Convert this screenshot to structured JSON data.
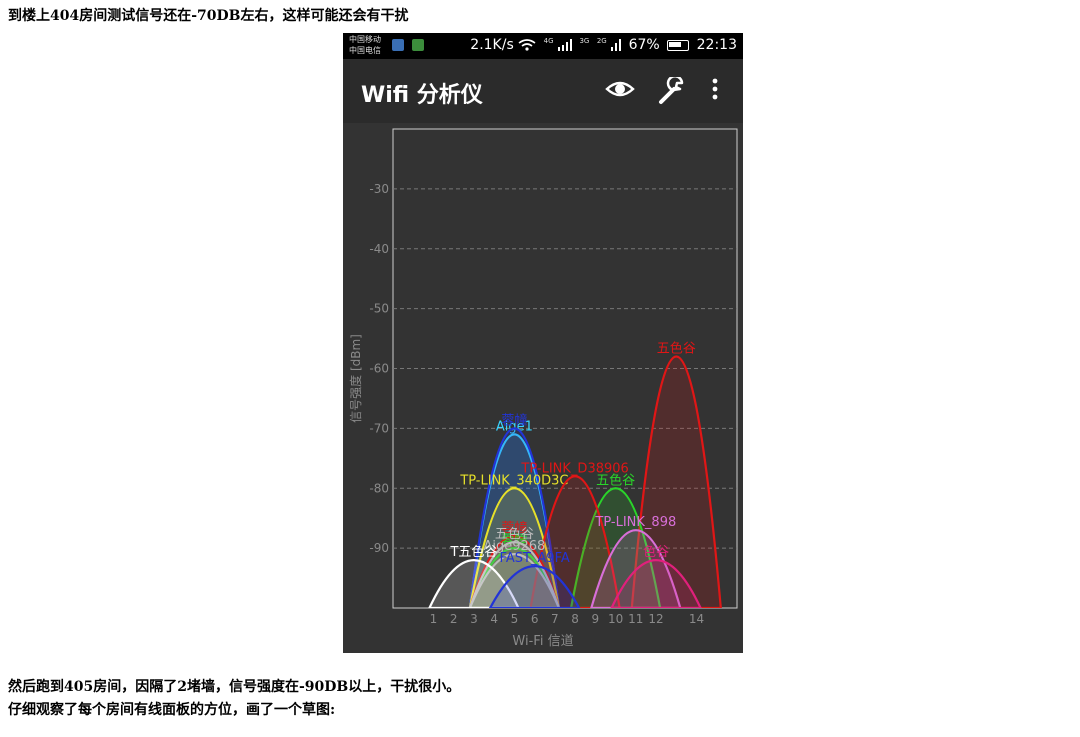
{
  "article": {
    "line1": "到楼上404房间测试信号还在-70DB左右，这样可能还会有干扰",
    "line2": "然后跑到405房间，因隔了2堵墙，信号强度在-90DB以上，干扰很小。",
    "line3": "仔细观察了每个房间有线面板的方位，画了一个草图:"
  },
  "status_bar": {
    "carrier1": "中国移动",
    "carrier2": "中国电信",
    "speed": "2.1K/s",
    "net_4g": "4G",
    "net_3g": "3G",
    "net_2g": "2G",
    "battery": "67%",
    "time": "22:13"
  },
  "app_bar": {
    "title": "Wifi 分析仪",
    "icons": [
      "eye-icon",
      "wrench-icon",
      "more-icon"
    ]
  },
  "chart_data": {
    "type": "area",
    "xlabel": "Wi-Fi 信道",
    "ylabel": "信号强度 [dBm]",
    "ylim": [
      -100,
      -20
    ],
    "yticks": [
      -30,
      -40,
      -50,
      -60,
      -70,
      -80,
      -90
    ],
    "xlim": [
      -1,
      16
    ],
    "xticks": [
      1,
      2,
      3,
      4,
      5,
      6,
      7,
      8,
      9,
      10,
      11,
      12,
      14
    ],
    "grid": true,
    "series": [
      {
        "name": "五色谷",
        "center": 13,
        "peak": -58,
        "color": "#e01616"
      },
      {
        "name": "Aige1",
        "center": 5,
        "peak": -71,
        "color": "#3ad4ff"
      },
      {
        "name": "蓉幢",
        "center": 5,
        "peak": -70,
        "color": "#2234d6"
      },
      {
        "name": "TP-LINK_340D3C",
        "center": 5,
        "peak": -80,
        "color": "#e6e02a"
      },
      {
        "name": "五色谷",
        "center": 10,
        "peak": -80,
        "color": "#2ad42a"
      },
      {
        "name": "TP-LINK_D38906",
        "center": 8,
        "peak": -78,
        "color": "#e01616"
      },
      {
        "name": "TP-LINK_898",
        "center": 11,
        "peak": -87,
        "color": "#d86fd8"
      },
      {
        "name": "蓉幢",
        "center": 5,
        "peak": -88,
        "color": "#e01616"
      },
      {
        "name": "蓉幢",
        "center": 5,
        "peak": -90,
        "color": "#2ad42a"
      },
      {
        "name": "五色谷",
        "center": 5,
        "peak": -89,
        "color": "#bbbbbb"
      },
      {
        "name": "Aige9268",
        "center": 5,
        "peak": -91,
        "color": "#bbbbbb"
      },
      {
        "name": "T五色谷",
        "center": 3,
        "peak": -92,
        "color": "#ffffff"
      },
      {
        "name": "FAST_A9FA",
        "center": 6,
        "peak": -93,
        "color": "#2234d6"
      },
      {
        "name": "色谷",
        "center": 12,
        "peak": -92,
        "color": "#e0207c"
      }
    ]
  }
}
